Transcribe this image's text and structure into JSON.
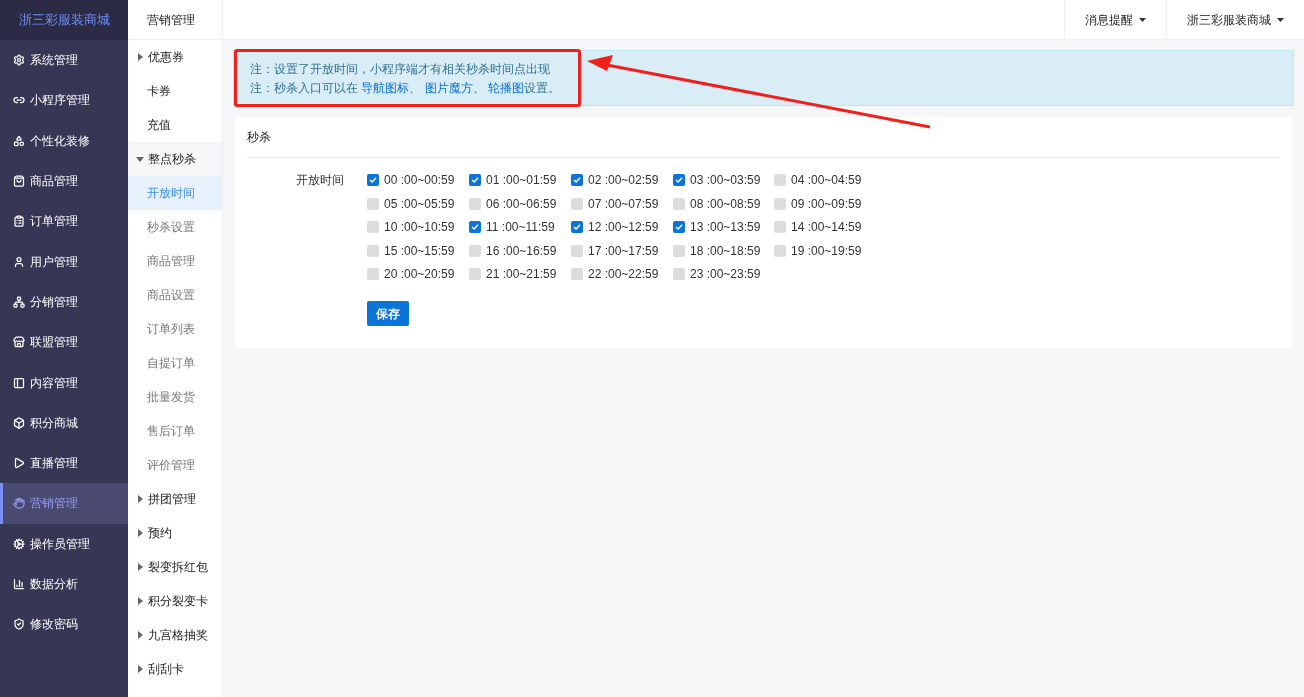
{
  "brand": "浙三彩服装商城",
  "sidebar": {
    "items": [
      {
        "label": "系统管理",
        "selected": false
      },
      {
        "label": "小程序管理",
        "selected": false
      },
      {
        "label": "个性化装修",
        "selected": false
      },
      {
        "label": "商品管理",
        "selected": false
      },
      {
        "label": "订单管理",
        "selected": false
      },
      {
        "label": "用户管理",
        "selected": false
      },
      {
        "label": "分销管理",
        "selected": false
      },
      {
        "label": "联盟管理",
        "selected": false
      },
      {
        "label": "内容管理",
        "selected": false
      },
      {
        "label": "积分商城",
        "selected": false
      },
      {
        "label": "直播管理",
        "selected": false
      },
      {
        "label": "营销管理",
        "selected": true
      },
      {
        "label": "操作员管理",
        "selected": false
      },
      {
        "label": "数据分析",
        "selected": false
      },
      {
        "label": "修改密码",
        "selected": false
      }
    ]
  },
  "subnav": {
    "title": "营销管理",
    "items": [
      {
        "kind": "group",
        "label": "优惠券",
        "expanded": false
      },
      {
        "kind": "link",
        "label": "卡券",
        "selected": false
      },
      {
        "kind": "link",
        "label": "充值",
        "selected": false
      },
      {
        "kind": "group",
        "label": "整点秒杀",
        "expanded": true,
        "children": [
          {
            "label": "开放时间",
            "selected": true
          },
          {
            "label": "秒杀设置",
            "selected": false
          },
          {
            "label": "商品管理",
            "selected": false
          },
          {
            "label": "商品设置",
            "selected": false
          },
          {
            "label": "订单列表",
            "selected": false
          },
          {
            "label": "自提订单",
            "selected": false
          },
          {
            "label": "批量发货",
            "selected": false
          },
          {
            "label": "售后订单",
            "selected": false
          },
          {
            "label": "评价管理",
            "selected": false
          }
        ]
      },
      {
        "kind": "group",
        "label": "拼团管理",
        "expanded": false
      },
      {
        "kind": "group",
        "label": "预约",
        "expanded": false
      },
      {
        "kind": "group",
        "label": "裂变拆红包",
        "expanded": false
      },
      {
        "kind": "group",
        "label": "积分裂变卡",
        "expanded": false
      },
      {
        "kind": "group",
        "label": "九宫格抽奖",
        "expanded": false
      },
      {
        "kind": "group",
        "label": "刮刮卡",
        "expanded": false
      }
    ]
  },
  "topbar": {
    "menus": [
      "消息提醒",
      "浙三彩服装商城"
    ]
  },
  "notice": {
    "lines": [
      [
        {
          "text": "注：设置了开放时间，小程序端才有相关秒杀时间点出现",
          "kind": "text"
        }
      ],
      [
        {
          "text": "注：秒杀入口可以在 ",
          "kind": "text"
        },
        {
          "text": "导航图标",
          "kind": "link"
        },
        {
          "text": "、 ",
          "kind": "text"
        },
        {
          "text": "图片魔方",
          "kind": "link"
        },
        {
          "text": "、 ",
          "kind": "text"
        },
        {
          "text": "轮播图",
          "kind": "link"
        },
        {
          "text": "设置。",
          "kind": "text"
        }
      ]
    ]
  },
  "card": {
    "title": "秒杀",
    "field_label": "开放时间",
    "slots": [
      {
        "label": "00 :00~00:59",
        "checked": true
      },
      {
        "label": "01 :00~01:59",
        "checked": true
      },
      {
        "label": "02 :00~02:59",
        "checked": true
      },
      {
        "label": "03 :00~03:59",
        "checked": true
      },
      {
        "label": "04 :00~04:59",
        "checked": false
      },
      {
        "label": "05 :00~05:59",
        "checked": false
      },
      {
        "label": "06 :00~06:59",
        "checked": false
      },
      {
        "label": "07 :00~07:59",
        "checked": false
      },
      {
        "label": "08 :00~08:59",
        "checked": false
      },
      {
        "label": "09 :00~09:59",
        "checked": false
      },
      {
        "label": "10 :00~10:59",
        "checked": false
      },
      {
        "label": "11 :00~11:59",
        "checked": true
      },
      {
        "label": "12 :00~12:59",
        "checked": true
      },
      {
        "label": "13 :00~13:59",
        "checked": true
      },
      {
        "label": "14 :00~14:59",
        "checked": false
      },
      {
        "label": "15 :00~15:59",
        "checked": false
      },
      {
        "label": "16 :00~16:59",
        "checked": false
      },
      {
        "label": "17 :00~17:59",
        "checked": false
      },
      {
        "label": "18 :00~18:59",
        "checked": false
      },
      {
        "label": "19 :00~19:59",
        "checked": false
      },
      {
        "label": "20 :00~20:59",
        "checked": false
      },
      {
        "label": "21 :00~21:59",
        "checked": false
      },
      {
        "label": "22 :00~22:59",
        "checked": false
      },
      {
        "label": "23 :00~23:59",
        "checked": false
      }
    ],
    "save_button": "保存"
  }
}
